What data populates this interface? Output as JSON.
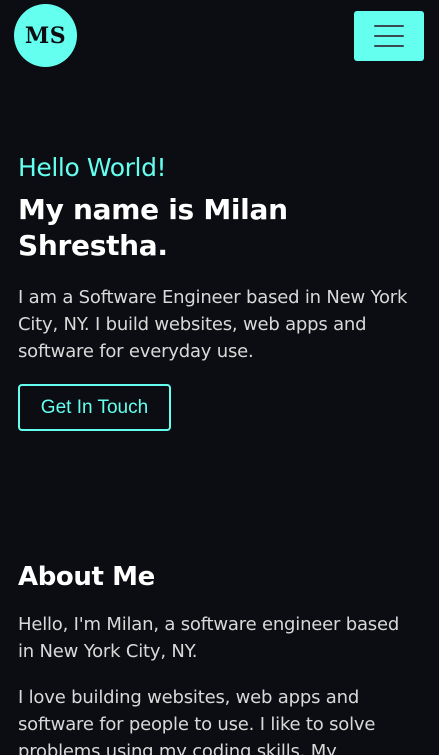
{
  "header": {
    "logo_text": "MS",
    "menu_icon": "hamburger-menu-icon"
  },
  "hero": {
    "greeting": "Hello World!",
    "name_line": "My name is Milan Shrestha.",
    "intro": "I am a Software Engineer based in New York City, NY. I build websites, web apps and software for everyday use.",
    "cta_label": "Get In Touch"
  },
  "about": {
    "title": "About Me",
    "paragraph_1": "Hello, I'm Milan, a software engineer based in New York City, NY.",
    "paragraph_2": "I love building websites, web apps and software for people to use. I like to solve problems using my coding skills. My"
  },
  "colors": {
    "background": "#0b0d12",
    "accent": "#64ffef",
    "heading": "#ffffff",
    "body_text": "#d9d9d9"
  }
}
